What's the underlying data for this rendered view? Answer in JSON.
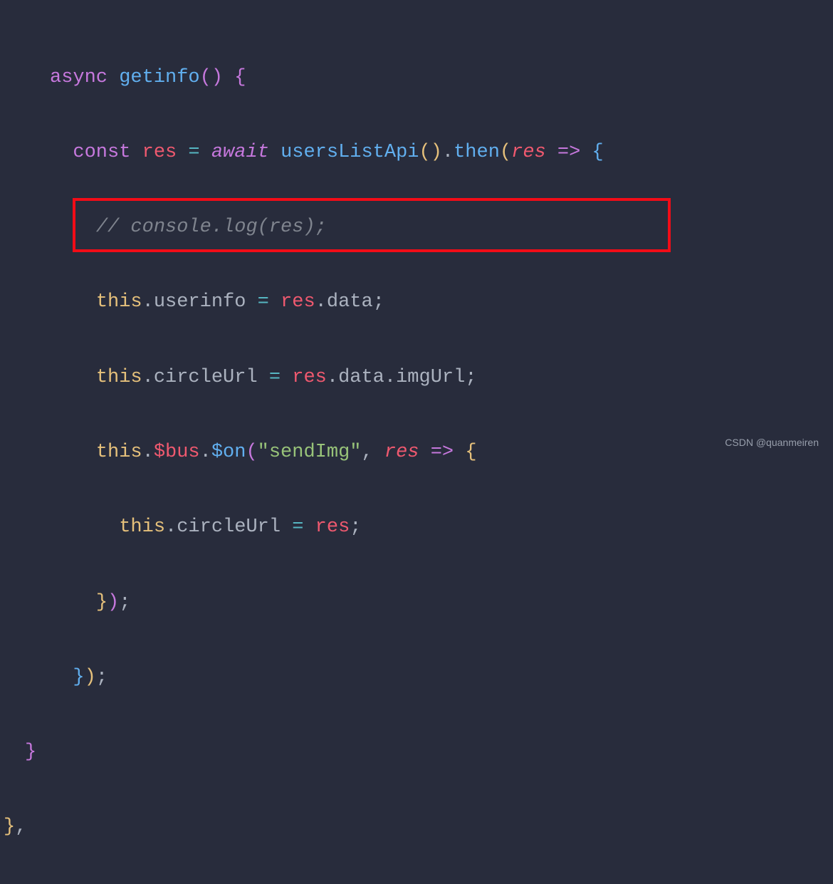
{
  "code": {
    "l1": {
      "async": "async",
      "fn": "getinfo",
      "paren_open": "(",
      "paren_close": ")",
      "brace": " {"
    },
    "l2": {
      "const": "const",
      "res": "res",
      "eq": " = ",
      "await": "await",
      "api": "usersListApi",
      "paren": "()",
      "dot": ".",
      "then": "then",
      "paren_open": "(",
      "param": "res",
      "arrow": " => ",
      "brace": "{"
    },
    "l3": {
      "comment": "// console.log(res);"
    },
    "l4": {
      "this": "this",
      "dot1": ".",
      "prop": "userinfo",
      "eq": " = ",
      "res": "res",
      "dot2": ".",
      "data": "data",
      "semi": ";"
    },
    "l5": {
      "this": "this",
      "dot1": ".",
      "prop": "circleUrl",
      "eq": " = ",
      "res": "res",
      "dot2": ".",
      "data": "data",
      "dot3": ".",
      "imgUrl": "imgUrl",
      "semi": ";"
    },
    "l6": {
      "this": "this",
      "dot1": ".",
      "bus": "$bus",
      "dot2": ".",
      "on": "$on",
      "paren_open": "(",
      "str": "\"sendImg\"",
      "comma": ", ",
      "param": "res",
      "arrow": " => ",
      "brace": "{"
    },
    "l7": {
      "this": "this",
      "dot1": ".",
      "prop": "circleUrl",
      "eq": " = ",
      "res": "res",
      "semi": ";"
    },
    "l8": {
      "brace": "}",
      "paren": ")",
      "semi": ";"
    },
    "l9": {
      "brace": "}",
      "paren": ")",
      "semi": ";"
    },
    "l10": {
      "brace": "}"
    },
    "l11": {
      "brace": "}",
      "comma": ","
    }
  },
  "watermark": "CSDN @quanmeiren"
}
